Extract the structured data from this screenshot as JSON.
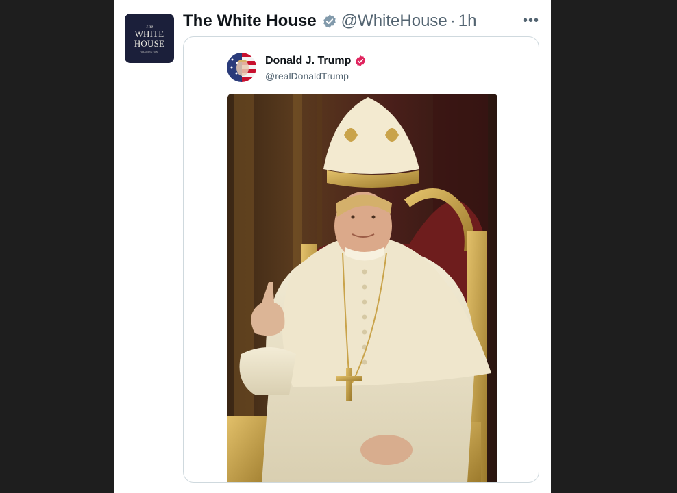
{
  "tweet": {
    "avatar": {
      "line1": "The",
      "line2": "WHITE",
      "line3": "HOUSE",
      "line4": "WASHINGTON"
    },
    "author_name": "The White House",
    "handle": "@WhiteHouse",
    "separator": "·",
    "time": "1h",
    "more_icon": "more-horizontal-icon",
    "badge_color": "#829aab"
  },
  "quoted": {
    "author_name": "Donald J. Trump",
    "handle": "@realDonaldTrump",
    "badge_color": "#e0245e",
    "media_description_icon": "image-of-figure-in-papal-vestments"
  },
  "colors": {
    "background": "#1e1e1e",
    "panel": "#ffffff",
    "text_primary": "#0f1419",
    "text_secondary": "#536471"
  }
}
